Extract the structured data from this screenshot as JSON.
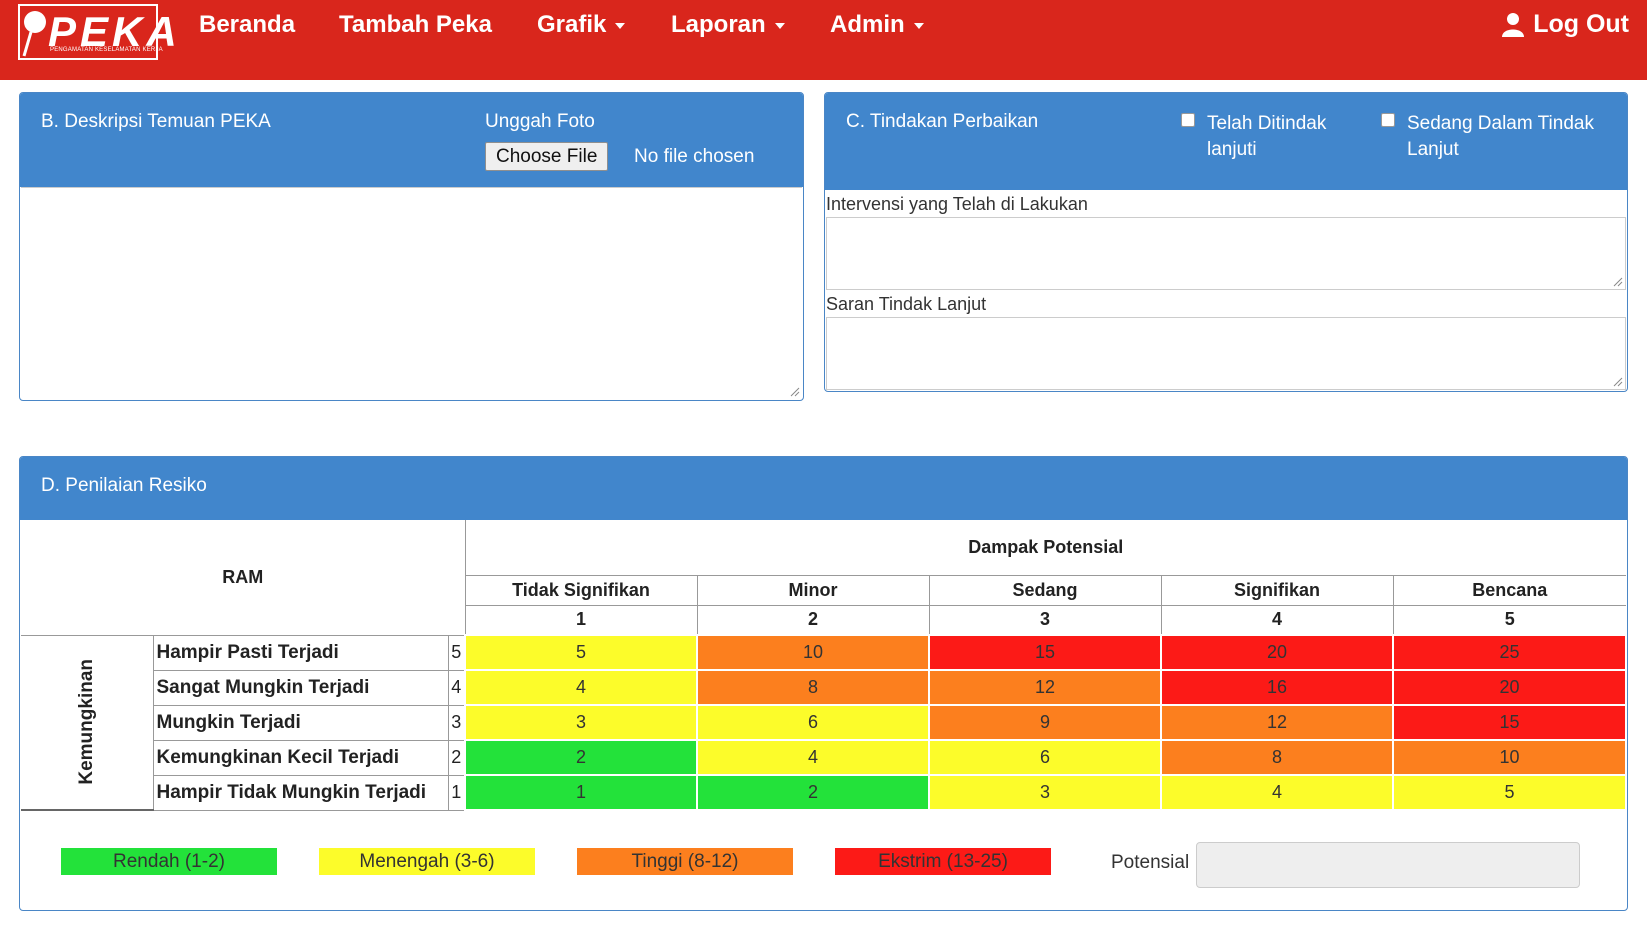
{
  "colors": {
    "navbar": "#d9261c",
    "panel_header": "#4186cc",
    "green": "#23e23a",
    "yellow": "#fcfc2a",
    "orange": "#fc7f1e",
    "red": "#fc1a17"
  },
  "navbar": {
    "logo_text": "PEKA",
    "logo_subtitle": "PENGAMATAN KESELAMATAN KERJA",
    "items": [
      {
        "label": "Beranda"
      },
      {
        "label": "Tambah Peka"
      },
      {
        "label": "Grafik"
      },
      {
        "label": "Laporan"
      },
      {
        "label": "Admin"
      }
    ],
    "logout_label": "Log Out",
    "logout_icon": "user-icon"
  },
  "panel_b": {
    "title": "B. Deskripsi Temuan PEKA",
    "upload_label": "Unggah Foto",
    "file_button": "Choose File",
    "file_status": "No file chosen"
  },
  "panel_c": {
    "title": "C. Tindakan Perbaikan",
    "checkbox_1_line1": "Telah Ditindak",
    "checkbox_1_line2": "lanjuti",
    "checkbox_2_line1": "Sedang Dalam Tindak",
    "checkbox_2_line2": "Lanjut",
    "intervensi_label": "Intervensi yang Telah di Lakukan",
    "saran_label": "Saran Tindak Lanjut"
  },
  "panel_d": {
    "title": "D. Penilaian Resiko",
    "ram_label": "RAM",
    "impact_header": "Dampak Potensial",
    "likelihood_header": "Kemungkinan",
    "impact_cols": [
      {
        "label": "Tidak Signifikan",
        "num": "1"
      },
      {
        "label": "Minor",
        "num": "2"
      },
      {
        "label": "Sedang",
        "num": "3"
      },
      {
        "label": "Signifikan",
        "num": "4"
      },
      {
        "label": "Bencana",
        "num": "5"
      }
    ],
    "rows": [
      {
        "label": "Hampir Pasti Terjadi",
        "num": "5",
        "values": [
          "5",
          "10",
          "15",
          "20",
          "25"
        ],
        "levels": [
          "yellow",
          "orange",
          "red",
          "red",
          "red"
        ]
      },
      {
        "label": "Sangat Mungkin Terjadi",
        "num": "4",
        "values": [
          "4",
          "8",
          "12",
          "16",
          "20"
        ],
        "levels": [
          "yellow",
          "orange",
          "orange",
          "red",
          "red"
        ]
      },
      {
        "label": "Mungkin Terjadi",
        "num": "3",
        "values": [
          "3",
          "6",
          "9",
          "12",
          "15"
        ],
        "levels": [
          "yellow",
          "yellow",
          "orange",
          "orange",
          "red"
        ]
      },
      {
        "label": "Kemungkinan Kecil Terjadi",
        "num": "2",
        "values": [
          "2",
          "4",
          "6",
          "8",
          "10"
        ],
        "levels": [
          "green",
          "yellow",
          "yellow",
          "orange",
          "orange"
        ]
      },
      {
        "label": "Hampir Tidak Mungkin Terjadi",
        "num": "1",
        "values": [
          "1",
          "2",
          "3",
          "4",
          "5"
        ],
        "levels": [
          "green",
          "green",
          "yellow",
          "yellow",
          "yellow"
        ]
      }
    ],
    "legend": [
      {
        "label": "Rendah (1-2)",
        "level": "green"
      },
      {
        "label": "Menengah (3-6)",
        "level": "yellow"
      },
      {
        "label": "Tinggi (8-12)",
        "level": "orange"
      },
      {
        "label": "Ekstrim (13-25)",
        "level": "red"
      }
    ],
    "potensial_label": "Potensial"
  }
}
